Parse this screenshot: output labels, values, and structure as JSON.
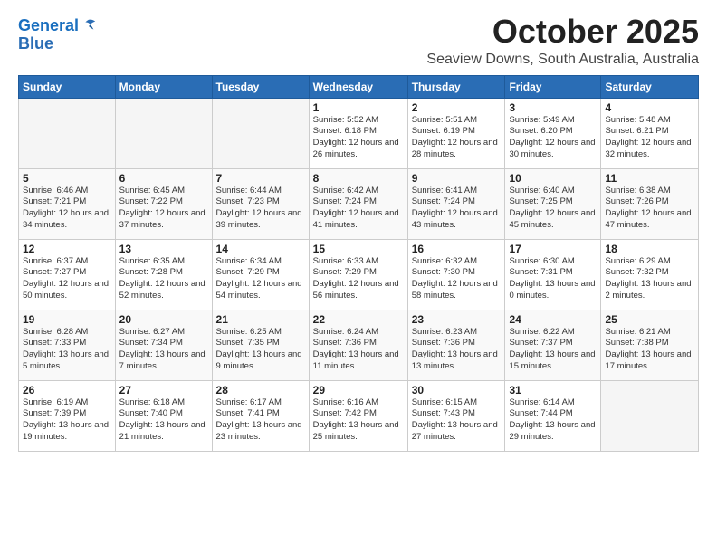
{
  "logo": {
    "line1": "General",
    "line2": "Blue"
  },
  "title": "October 2025",
  "subtitle": "Seaview Downs, South Australia, Australia",
  "days_header": [
    "Sunday",
    "Monday",
    "Tuesday",
    "Wednesday",
    "Thursday",
    "Friday",
    "Saturday"
  ],
  "weeks": [
    [
      {
        "num": "",
        "info": ""
      },
      {
        "num": "",
        "info": ""
      },
      {
        "num": "",
        "info": ""
      },
      {
        "num": "1",
        "info": "Sunrise: 5:52 AM\nSunset: 6:18 PM\nDaylight: 12 hours\nand 26 minutes."
      },
      {
        "num": "2",
        "info": "Sunrise: 5:51 AM\nSunset: 6:19 PM\nDaylight: 12 hours\nand 28 minutes."
      },
      {
        "num": "3",
        "info": "Sunrise: 5:49 AM\nSunset: 6:20 PM\nDaylight: 12 hours\nand 30 minutes."
      },
      {
        "num": "4",
        "info": "Sunrise: 5:48 AM\nSunset: 6:21 PM\nDaylight: 12 hours\nand 32 minutes."
      }
    ],
    [
      {
        "num": "5",
        "info": "Sunrise: 6:46 AM\nSunset: 7:21 PM\nDaylight: 12 hours\nand 34 minutes."
      },
      {
        "num": "6",
        "info": "Sunrise: 6:45 AM\nSunset: 7:22 PM\nDaylight: 12 hours\nand 37 minutes."
      },
      {
        "num": "7",
        "info": "Sunrise: 6:44 AM\nSunset: 7:23 PM\nDaylight: 12 hours\nand 39 minutes."
      },
      {
        "num": "8",
        "info": "Sunrise: 6:42 AM\nSunset: 7:24 PM\nDaylight: 12 hours\nand 41 minutes."
      },
      {
        "num": "9",
        "info": "Sunrise: 6:41 AM\nSunset: 7:24 PM\nDaylight: 12 hours\nand 43 minutes."
      },
      {
        "num": "10",
        "info": "Sunrise: 6:40 AM\nSunset: 7:25 PM\nDaylight: 12 hours\nand 45 minutes."
      },
      {
        "num": "11",
        "info": "Sunrise: 6:38 AM\nSunset: 7:26 PM\nDaylight: 12 hours\nand 47 minutes."
      }
    ],
    [
      {
        "num": "12",
        "info": "Sunrise: 6:37 AM\nSunset: 7:27 PM\nDaylight: 12 hours\nand 50 minutes."
      },
      {
        "num": "13",
        "info": "Sunrise: 6:35 AM\nSunset: 7:28 PM\nDaylight: 12 hours\nand 52 minutes."
      },
      {
        "num": "14",
        "info": "Sunrise: 6:34 AM\nSunset: 7:29 PM\nDaylight: 12 hours\nand 54 minutes."
      },
      {
        "num": "15",
        "info": "Sunrise: 6:33 AM\nSunset: 7:29 PM\nDaylight: 12 hours\nand 56 minutes."
      },
      {
        "num": "16",
        "info": "Sunrise: 6:32 AM\nSunset: 7:30 PM\nDaylight: 12 hours\nand 58 minutes."
      },
      {
        "num": "17",
        "info": "Sunrise: 6:30 AM\nSunset: 7:31 PM\nDaylight: 13 hours\nand 0 minutes."
      },
      {
        "num": "18",
        "info": "Sunrise: 6:29 AM\nSunset: 7:32 PM\nDaylight: 13 hours\nand 2 minutes."
      }
    ],
    [
      {
        "num": "19",
        "info": "Sunrise: 6:28 AM\nSunset: 7:33 PM\nDaylight: 13 hours\nand 5 minutes."
      },
      {
        "num": "20",
        "info": "Sunrise: 6:27 AM\nSunset: 7:34 PM\nDaylight: 13 hours\nand 7 minutes."
      },
      {
        "num": "21",
        "info": "Sunrise: 6:25 AM\nSunset: 7:35 PM\nDaylight: 13 hours\nand 9 minutes."
      },
      {
        "num": "22",
        "info": "Sunrise: 6:24 AM\nSunset: 7:36 PM\nDaylight: 13 hours\nand 11 minutes."
      },
      {
        "num": "23",
        "info": "Sunrise: 6:23 AM\nSunset: 7:36 PM\nDaylight: 13 hours\nand 13 minutes."
      },
      {
        "num": "24",
        "info": "Sunrise: 6:22 AM\nSunset: 7:37 PM\nDaylight: 13 hours\nand 15 minutes."
      },
      {
        "num": "25",
        "info": "Sunrise: 6:21 AM\nSunset: 7:38 PM\nDaylight: 13 hours\nand 17 minutes."
      }
    ],
    [
      {
        "num": "26",
        "info": "Sunrise: 6:19 AM\nSunset: 7:39 PM\nDaylight: 13 hours\nand 19 minutes."
      },
      {
        "num": "27",
        "info": "Sunrise: 6:18 AM\nSunset: 7:40 PM\nDaylight: 13 hours\nand 21 minutes."
      },
      {
        "num": "28",
        "info": "Sunrise: 6:17 AM\nSunset: 7:41 PM\nDaylight: 13 hours\nand 23 minutes."
      },
      {
        "num": "29",
        "info": "Sunrise: 6:16 AM\nSunset: 7:42 PM\nDaylight: 13 hours\nand 25 minutes."
      },
      {
        "num": "30",
        "info": "Sunrise: 6:15 AM\nSunset: 7:43 PM\nDaylight: 13 hours\nand 27 minutes."
      },
      {
        "num": "31",
        "info": "Sunrise: 6:14 AM\nSunset: 7:44 PM\nDaylight: 13 hours\nand 29 minutes."
      },
      {
        "num": "",
        "info": ""
      }
    ]
  ]
}
